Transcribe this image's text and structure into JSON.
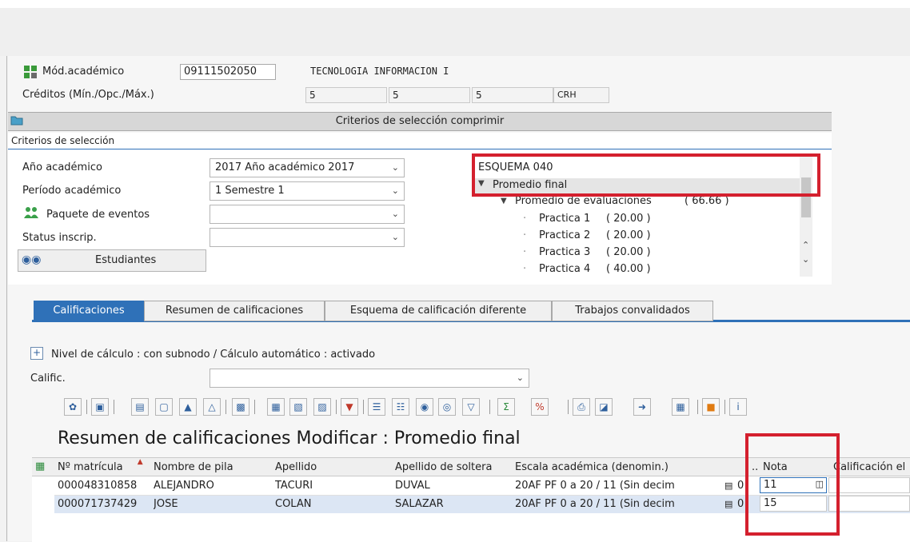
{
  "header": {
    "modulo_label": "Mód.académico",
    "modulo_code": "09111502050",
    "modulo_name": "TECNOLOGIA INFORMACION I",
    "creditos_label": "Créditos (Mín./Opc./Máx.)",
    "cred_min": "5",
    "cred_opc": "5",
    "cred_max": "5",
    "cred_unit": "CRH"
  },
  "section_bar": {
    "label": "Criterios de selección comprimir"
  },
  "criteria": {
    "title": "Criterios de selección",
    "anio_label": "Año académico",
    "anio_value": "2017 Año académico 2017",
    "periodo_label": "Período académico",
    "periodo_value": "1 Semestre 1",
    "paquete_label": "Paquete de eventos",
    "paquete_value": "",
    "status_label": "Status inscrip.",
    "status_value": "",
    "students_button": "Estudiantes"
  },
  "tree": {
    "root": "ESQUEMA 040",
    "node": "Promedio final",
    "child": "Promedio de evaluaciones",
    "child_value": "( 66.66 )",
    "items": [
      {
        "label": "Practica 1",
        "value": "( 20.00 )"
      },
      {
        "label": "Practica 2",
        "value": "( 20.00 )"
      },
      {
        "label": "Practica 3",
        "value": "( 20.00 )"
      },
      {
        "label": "Practica 4",
        "value": "( 40.00 )"
      }
    ]
  },
  "tabs": [
    {
      "label": "Calificaciones",
      "active": true
    },
    {
      "label": "Resumen de calificaciones",
      "active": false
    },
    {
      "label": "Esquema de calificación diferente",
      "active": false
    },
    {
      "label": "Trabajos convalidados",
      "active": false
    }
  ],
  "calc": {
    "nivel_text": "Nivel de cálculo : con subnodo / Cálculo automático : activado",
    "calific_label": "Calific.",
    "calific_value": ""
  },
  "grid": {
    "title": "Resumen de calificaciones Modificar : Promedio final",
    "columns": {
      "matricula": "Nº matrícula",
      "nombre": "Nombre de pila",
      "apellido": "Apellido",
      "soltera": "Apellido de soltera",
      "escala": "Escala académica (denomin.)",
      "dots": "..",
      "nota": "Nota",
      "calificacion": "Calificación el"
    },
    "rows": [
      {
        "matricula": "000048310858",
        "nombre": "ALEJANDRO",
        "apellido": "TACURI",
        "soltera": "DUVAL",
        "escala": "20AF PF 0 a 20 / 11 (Sin decim",
        "num": "0",
        "nota": "11"
      },
      {
        "matricula": "000071737429",
        "nombre": "JOSE",
        "apellido": "COLAN",
        "soltera": "SALAZAR",
        "escala": "20AF PF 0 a 20 / 11 (Sin decim",
        "num": "0",
        "nota": "15"
      }
    ]
  },
  "colors": {
    "tab_active": "#2f71b8",
    "highlight": "#d4202e",
    "row_selected": "#dce6f4"
  }
}
